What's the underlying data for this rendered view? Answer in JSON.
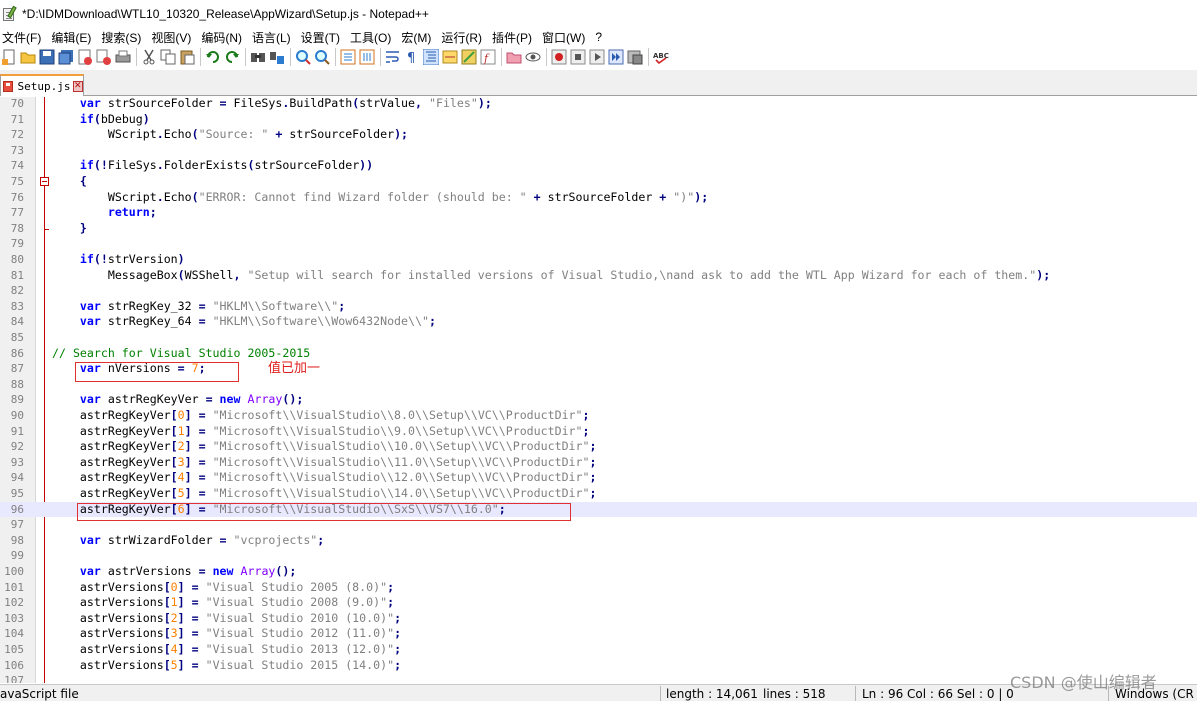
{
  "window": {
    "title": "*D:\\IDMDownload\\WTL10_10320_Release\\AppWizard\\Setup.js - Notepad++"
  },
  "menu": [
    "文件(F)",
    "编辑(E)",
    "搜索(S)",
    "视图(V)",
    "编码(N)",
    "语言(L)",
    "设置(T)",
    "工具(O)",
    "宏(M)",
    "运行(R)",
    "插件(P)",
    "窗口(W)",
    "?"
  ],
  "toolbar": {
    "icons": [
      "new-file-icon",
      "open-file-icon",
      "save-icon",
      "save-all-icon",
      "close-icon",
      "close-all-icon",
      "print-icon",
      "cut-icon",
      "copy-icon",
      "paste-icon",
      "undo-icon",
      "redo-icon",
      "find-icon",
      "replace-icon",
      "zoom-in-icon",
      "zoom-out-icon",
      "sync-vertical-icon",
      "sync-horizontal-icon",
      "word-wrap-icon",
      "show-all-characters-icon",
      "indent-guide-icon",
      "user-language-icon",
      "doc-map-icon",
      "function-list-icon",
      "folder-workspace-icon",
      "monitor-icon",
      "record-macro-icon",
      "stop-record-icon",
      "play-macro-icon",
      "run-macro-multiple-icon",
      "save-macro-icon",
      "spell-check-icon"
    ]
  },
  "tab": {
    "label": "Setup.js",
    "close": "✕"
  },
  "editor": {
    "lines": [
      {
        "n": "70",
        "code": [
          [
            "",
            "    "
          ],
          [
            "kw",
            "var"
          ],
          [
            "",
            " strSourceFolder "
          ],
          [
            "op",
            "="
          ],
          [
            "",
            " FileSys"
          ],
          [
            "op",
            "."
          ],
          [
            "",
            "BuildPath"
          ],
          [
            "op",
            "("
          ],
          [
            "",
            "strValue"
          ],
          [
            "op",
            ","
          ],
          [
            "",
            " "
          ],
          [
            "str",
            "\"Files\""
          ],
          [
            "op",
            ");"
          ]
        ]
      },
      {
        "n": "71",
        "code": [
          [
            "",
            "    "
          ],
          [
            "kw",
            "if"
          ],
          [
            "op",
            "("
          ],
          [
            "",
            "bDebug"
          ],
          [
            "op",
            ")"
          ]
        ]
      },
      {
        "n": "72",
        "code": [
          [
            "",
            "        WScript"
          ],
          [
            "op",
            "."
          ],
          [
            "",
            "Echo"
          ],
          [
            "op",
            "("
          ],
          [
            "str",
            "\"Source: \""
          ],
          [
            "",
            " "
          ],
          [
            "op",
            "+"
          ],
          [
            "",
            " strSourceFolder"
          ],
          [
            "op",
            ");"
          ]
        ]
      },
      {
        "n": "73",
        "code": []
      },
      {
        "n": "74",
        "code": [
          [
            "",
            "    "
          ],
          [
            "kw",
            "if"
          ],
          [
            "op",
            "(!"
          ],
          [
            "",
            "FileSys"
          ],
          [
            "op",
            "."
          ],
          [
            "",
            "FolderExists"
          ],
          [
            "op",
            "("
          ],
          [
            "",
            "strSourceFolder"
          ],
          [
            "op",
            "))"
          ]
        ]
      },
      {
        "n": "75",
        "code": [
          [
            "",
            "    "
          ],
          [
            "op",
            "{"
          ]
        ]
      },
      {
        "n": "76",
        "code": [
          [
            "",
            "        WScript"
          ],
          [
            "op",
            "."
          ],
          [
            "",
            "Echo"
          ],
          [
            "op",
            "("
          ],
          [
            "str",
            "\"ERROR: Cannot find Wizard folder (should be: \""
          ],
          [
            "",
            " "
          ],
          [
            "op",
            "+"
          ],
          [
            "",
            " strSourceFolder "
          ],
          [
            "op",
            "+"
          ],
          [
            "",
            " "
          ],
          [
            "str",
            "\")\""
          ],
          [
            "op",
            ");"
          ]
        ]
      },
      {
        "n": "77",
        "code": [
          [
            "",
            "        "
          ],
          [
            "kw",
            "return"
          ],
          [
            "op",
            ";"
          ]
        ]
      },
      {
        "n": "78",
        "code": [
          [
            "",
            "    "
          ],
          [
            "op",
            "}"
          ]
        ]
      },
      {
        "n": "79",
        "code": []
      },
      {
        "n": "80",
        "code": [
          [
            "",
            "    "
          ],
          [
            "kw",
            "if"
          ],
          [
            "op",
            "(!"
          ],
          [
            "",
            "strVersion"
          ],
          [
            "op",
            ")"
          ]
        ]
      },
      {
        "n": "81",
        "code": [
          [
            "",
            "        MessageBox"
          ],
          [
            "op",
            "("
          ],
          [
            "",
            "WSShell"
          ],
          [
            "op",
            ","
          ],
          [
            "",
            " "
          ],
          [
            "str",
            "\"Setup will search for installed versions of Visual Studio,\\nand ask to add the WTL App Wizard for each of them.\""
          ],
          [
            "op",
            ");"
          ]
        ]
      },
      {
        "n": "82",
        "code": []
      },
      {
        "n": "83",
        "code": [
          [
            "",
            "    "
          ],
          [
            "kw",
            "var"
          ],
          [
            "",
            " strRegKey_32 "
          ],
          [
            "op",
            "="
          ],
          [
            "",
            " "
          ],
          [
            "str",
            "\"HKLM\\\\Software\\\\\""
          ],
          [
            "op",
            ";"
          ]
        ]
      },
      {
        "n": "84",
        "code": [
          [
            "",
            "    "
          ],
          [
            "kw",
            "var"
          ],
          [
            "",
            " strRegKey_64 "
          ],
          [
            "op",
            "="
          ],
          [
            "",
            " "
          ],
          [
            "str",
            "\"HKLM\\\\Software\\\\Wow6432Node\\\\\""
          ],
          [
            "op",
            ";"
          ]
        ]
      },
      {
        "n": "85",
        "code": []
      },
      {
        "n": "86",
        "code": [
          [
            "cmt",
            "// Search for Visual Studio 2005-2015"
          ]
        ]
      },
      {
        "n": "87",
        "code": [
          [
            "",
            "    "
          ],
          [
            "kw",
            "var"
          ],
          [
            "",
            " nVersions "
          ],
          [
            "op",
            "="
          ],
          [
            "",
            " "
          ],
          [
            "num",
            "7"
          ],
          [
            "op",
            ";"
          ]
        ]
      },
      {
        "n": "88",
        "code": []
      },
      {
        "n": "89",
        "code": [
          [
            "",
            "    "
          ],
          [
            "kw",
            "var"
          ],
          [
            "",
            " astrRegKeyVer "
          ],
          [
            "op",
            "="
          ],
          [
            "",
            " "
          ],
          [
            "kw",
            "new"
          ],
          [
            "",
            " "
          ],
          [
            "obj",
            "Array"
          ],
          [
            "op",
            "();"
          ]
        ]
      },
      {
        "n": "90",
        "code": [
          [
            "",
            "    astrRegKeyVer"
          ],
          [
            "op",
            "["
          ],
          [
            "num",
            "0"
          ],
          [
            "op",
            "]"
          ],
          [
            "",
            " "
          ],
          [
            "op",
            "="
          ],
          [
            "",
            " "
          ],
          [
            "str",
            "\"Microsoft\\\\VisualStudio\\\\8.0\\\\Setup\\\\VC\\\\ProductDir\""
          ],
          [
            "op",
            ";"
          ]
        ]
      },
      {
        "n": "91",
        "code": [
          [
            "",
            "    astrRegKeyVer"
          ],
          [
            "op",
            "["
          ],
          [
            "num",
            "1"
          ],
          [
            "op",
            "]"
          ],
          [
            "",
            " "
          ],
          [
            "op",
            "="
          ],
          [
            "",
            " "
          ],
          [
            "str",
            "\"Microsoft\\\\VisualStudio\\\\9.0\\\\Setup\\\\VC\\\\ProductDir\""
          ],
          [
            "op",
            ";"
          ]
        ]
      },
      {
        "n": "92",
        "code": [
          [
            "",
            "    astrRegKeyVer"
          ],
          [
            "op",
            "["
          ],
          [
            "num",
            "2"
          ],
          [
            "op",
            "]"
          ],
          [
            "",
            " "
          ],
          [
            "op",
            "="
          ],
          [
            "",
            " "
          ],
          [
            "str",
            "\"Microsoft\\\\VisualStudio\\\\10.0\\\\Setup\\\\VC\\\\ProductDir\""
          ],
          [
            "op",
            ";"
          ]
        ]
      },
      {
        "n": "93",
        "code": [
          [
            "",
            "    astrRegKeyVer"
          ],
          [
            "op",
            "["
          ],
          [
            "num",
            "3"
          ],
          [
            "op",
            "]"
          ],
          [
            "",
            " "
          ],
          [
            "op",
            "="
          ],
          [
            "",
            " "
          ],
          [
            "str",
            "\"Microsoft\\\\VisualStudio\\\\11.0\\\\Setup\\\\VC\\\\ProductDir\""
          ],
          [
            "op",
            ";"
          ]
        ]
      },
      {
        "n": "94",
        "code": [
          [
            "",
            "    astrRegKeyVer"
          ],
          [
            "op",
            "["
          ],
          [
            "num",
            "4"
          ],
          [
            "op",
            "]"
          ],
          [
            "",
            " "
          ],
          [
            "op",
            "="
          ],
          [
            "",
            " "
          ],
          [
            "str",
            "\"Microsoft\\\\VisualStudio\\\\12.0\\\\Setup\\\\VC\\\\ProductDir\""
          ],
          [
            "op",
            ";"
          ]
        ]
      },
      {
        "n": "95",
        "code": [
          [
            "",
            "    astrRegKeyVer"
          ],
          [
            "op",
            "["
          ],
          [
            "num",
            "5"
          ],
          [
            "op",
            "]"
          ],
          [
            "",
            " "
          ],
          [
            "op",
            "="
          ],
          [
            "",
            " "
          ],
          [
            "str",
            "\"Microsoft\\\\VisualStudio\\\\14.0\\\\Setup\\\\VC\\\\ProductDir\""
          ],
          [
            "op",
            ";"
          ]
        ]
      },
      {
        "n": "96",
        "code": [
          [
            "",
            "    astrRegKeyVer"
          ],
          [
            "op",
            "["
          ],
          [
            "num",
            "6"
          ],
          [
            "op",
            "]"
          ],
          [
            "",
            " "
          ],
          [
            "op",
            "="
          ],
          [
            "",
            " "
          ],
          [
            "str",
            "\"Microsoft\\\\VisualStudio\\\\SxS\\\\VS7\\\\16.0\""
          ],
          [
            "op",
            ";"
          ]
        ]
      },
      {
        "n": "97",
        "code": []
      },
      {
        "n": "98",
        "code": [
          [
            "",
            "    "
          ],
          [
            "kw",
            "var"
          ],
          [
            "",
            " strWizardFolder "
          ],
          [
            "op",
            "="
          ],
          [
            "",
            " "
          ],
          [
            "str",
            "\"vcprojects\""
          ],
          [
            "op",
            ";"
          ]
        ]
      },
      {
        "n": "99",
        "code": []
      },
      {
        "n": "100",
        "code": [
          [
            "",
            "    "
          ],
          [
            "kw",
            "var"
          ],
          [
            "",
            " astrVersions "
          ],
          [
            "op",
            "="
          ],
          [
            "",
            " "
          ],
          [
            "kw",
            "new"
          ],
          [
            "",
            " "
          ],
          [
            "obj",
            "Array"
          ],
          [
            "op",
            "();"
          ]
        ]
      },
      {
        "n": "101",
        "code": [
          [
            "",
            "    astrVersions"
          ],
          [
            "op",
            "["
          ],
          [
            "num",
            "0"
          ],
          [
            "op",
            "]"
          ],
          [
            "",
            " "
          ],
          [
            "op",
            "="
          ],
          [
            "",
            " "
          ],
          [
            "str",
            "\"Visual Studio 2005 (8.0)\""
          ],
          [
            "op",
            ";"
          ]
        ]
      },
      {
        "n": "102",
        "code": [
          [
            "",
            "    astrVersions"
          ],
          [
            "op",
            "["
          ],
          [
            "num",
            "1"
          ],
          [
            "op",
            "]"
          ],
          [
            "",
            " "
          ],
          [
            "op",
            "="
          ],
          [
            "",
            " "
          ],
          [
            "str",
            "\"Visual Studio 2008 (9.0)\""
          ],
          [
            "op",
            ";"
          ]
        ]
      },
      {
        "n": "103",
        "code": [
          [
            "",
            "    astrVersions"
          ],
          [
            "op",
            "["
          ],
          [
            "num",
            "2"
          ],
          [
            "op",
            "]"
          ],
          [
            "",
            " "
          ],
          [
            "op",
            "="
          ],
          [
            "",
            " "
          ],
          [
            "str",
            "\"Visual Studio 2010 (10.0)\""
          ],
          [
            "op",
            ";"
          ]
        ]
      },
      {
        "n": "104",
        "code": [
          [
            "",
            "    astrVersions"
          ],
          [
            "op",
            "["
          ],
          [
            "num",
            "3"
          ],
          [
            "op",
            "]"
          ],
          [
            "",
            " "
          ],
          [
            "op",
            "="
          ],
          [
            "",
            " "
          ],
          [
            "str",
            "\"Visual Studio 2012 (11.0)\""
          ],
          [
            "op",
            ";"
          ]
        ]
      },
      {
        "n": "105",
        "code": [
          [
            "",
            "    astrVersions"
          ],
          [
            "op",
            "["
          ],
          [
            "num",
            "4"
          ],
          [
            "op",
            "]"
          ],
          [
            "",
            " "
          ],
          [
            "op",
            "="
          ],
          [
            "",
            " "
          ],
          [
            "str",
            "\"Visual Studio 2013 (12.0)\""
          ],
          [
            "op",
            ";"
          ]
        ]
      },
      {
        "n": "106",
        "code": [
          [
            "",
            "    astrVersions"
          ],
          [
            "op",
            "["
          ],
          [
            "num",
            "5"
          ],
          [
            "op",
            "]"
          ],
          [
            "",
            " "
          ],
          [
            "op",
            "="
          ],
          [
            "",
            " "
          ],
          [
            "str",
            "\"Visual Studio 2015 (14.0)\""
          ],
          [
            "op",
            ";"
          ]
        ]
      },
      {
        "n": "107",
        "code": []
      }
    ],
    "current_line": "96",
    "annotation": "值已加一"
  },
  "statusbar": {
    "file_type": "avaScript file",
    "length": "length : 14,061",
    "lines": "lines : 518",
    "position": "Ln : 96   Col : 66   Sel : 0 | 0",
    "eol": "Windows (CR LF)"
  },
  "watermark": "CSDN @使山编辑者"
}
